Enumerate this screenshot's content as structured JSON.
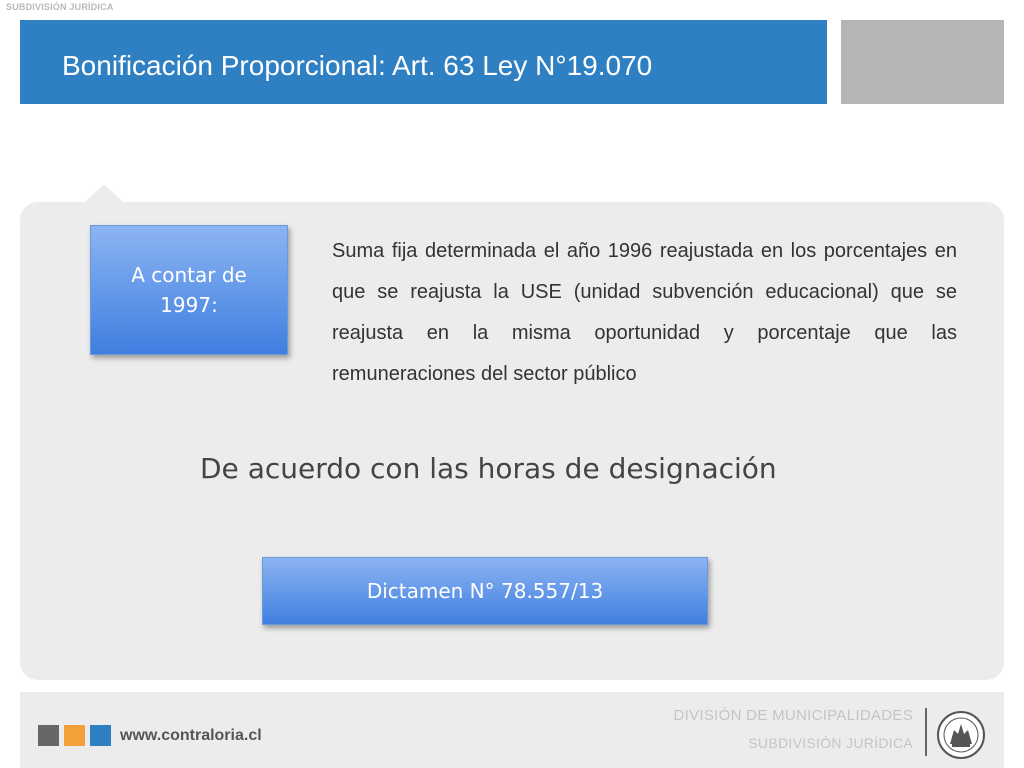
{
  "header": {
    "top_label": "SUBDIVISIÓN JURÍDICA",
    "title": "Bonificación Proporcional: Art. 63 Ley N°19.070"
  },
  "content": {
    "box_label": "A contar de 1997:",
    "paragraph": "Suma fija determinada el año 1996 reajustada en los porcentajes en que se reajusta la USE (unidad subvención educacional) que se reajusta en la misma oportunidad y porcentaje que las remuneraciones del sector público",
    "subheading": "De acuerdo con las horas de designación",
    "dictamen_label": "Dictamen N° 78.557/13"
  },
  "footer": {
    "url": "www.contraloria.cl",
    "division": "DIVISIÓN DE MUNICIPALIDADES",
    "subdivision": "SUBDIVISIÓN JURÍDICA",
    "seal_icon": "contraloria-seal-icon"
  },
  "colors": {
    "accent_blue": "#2f7fc3",
    "accent_orange": "#f2a03a",
    "accent_gray": "#676767",
    "panel_bg": "#ececec"
  }
}
